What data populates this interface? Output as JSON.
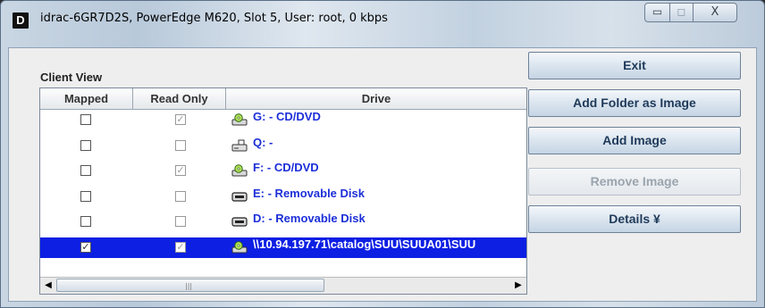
{
  "window": {
    "title": "idrac-6GR7D2S, PowerEdge M620,  Slot 5, User: root, 0 kbps",
    "app_icon": "D",
    "controls": {
      "minimize": "▭",
      "maximize": "◻",
      "close": "X"
    }
  },
  "client_view": {
    "label": "Client View",
    "columns": [
      "Mapped",
      "Read Only",
      "Drive"
    ],
    "rows": [
      {
        "mapped": false,
        "read_only": true,
        "drive_icon": "cd-drive-icon",
        "drive": "G: - CD/DVD",
        "selected": false
      },
      {
        "mapped": false,
        "read_only": false,
        "drive_icon": "network-drive-icon",
        "drive": "Q: -",
        "selected": false
      },
      {
        "mapped": false,
        "read_only": true,
        "drive_icon": "cd-drive-icon",
        "drive": "F: - CD/DVD",
        "selected": false
      },
      {
        "mapped": false,
        "read_only": false,
        "drive_icon": "removable-disk-icon",
        "drive": "E: - Removable Disk",
        "selected": false
      },
      {
        "mapped": false,
        "read_only": false,
        "drive_icon": "removable-disk-icon",
        "drive": "D: - Removable Disk",
        "selected": false
      },
      {
        "mapped": true,
        "read_only": true,
        "drive_icon": "cd-drive-icon",
        "drive": "\\\\10.94.197.71\\catalog\\SUU\\SUUA01\\SUU",
        "selected": true
      }
    ],
    "selection_color": "#0d1fe3"
  },
  "actions": {
    "exit": "Exit",
    "add_folder": "Add Folder as Image",
    "add_image": "Add Image",
    "remove_image": "Remove Image",
    "details": "Details ¥"
  },
  "colors": {
    "drive_text": "#1c2fd8",
    "button_text": "#1f3a5a"
  }
}
